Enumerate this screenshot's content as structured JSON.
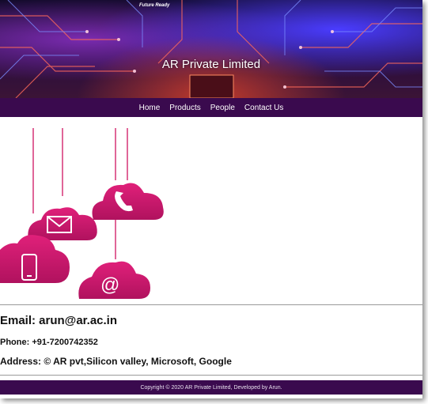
{
  "header": {
    "tagline": "Future Ready",
    "title": "AR Private Limited"
  },
  "nav": {
    "items": [
      "Home",
      "Products",
      "People",
      "Contact Us"
    ]
  },
  "contact": {
    "email": "Email: arun@ar.ac.in",
    "phone": "Phone: +91-7200742352",
    "address": "Address: © AR pvt,Silicon valley, Microsoft, Google"
  },
  "footer": {
    "text": "Copyright © 2020 AR Private Limited, Developed by Arun."
  },
  "colors": {
    "brand_purple": "#3a0a4e",
    "cloud_pink": "#d81b72"
  }
}
